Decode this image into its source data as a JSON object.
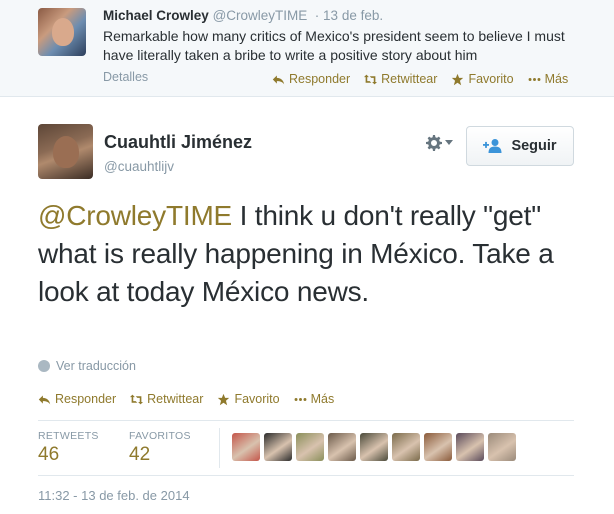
{
  "parent_tweet": {
    "author_name": "Michael Crowley",
    "author_handle": "@CrowleyTIME",
    "time": "13 de feb.",
    "text": "Remarkable how many critics of Mexico's president seem to believe I must have literally taken a bribe to write a positive story about him",
    "details_label": "Detalles",
    "actions": {
      "reply": "Responder",
      "retweet": "Retwittear",
      "favorite": "Favorito",
      "more": "Más"
    }
  },
  "tweet": {
    "author_name": "Cuauhtli Jiménez",
    "author_handle": "@cuauhtlijv",
    "follow_label": "Seguir",
    "mention": "@CrowleyTIME",
    "text": " I think u don't really \"get\" what is really happening in México. Take a look at today México news.",
    "translate_label": "Ver traducción",
    "actions": {
      "reply": "Responder",
      "retweet": "Retwittear",
      "favorite": "Favorito",
      "more": "Más"
    },
    "stats": {
      "retweets_label": "RETWEETS",
      "retweets_count": "46",
      "favorites_label": "FAVORITOS",
      "favorites_count": "42"
    },
    "favoriters_avatar_colors": [
      "#c4564a",
      "#2b2b2b",
      "#8a8f5a",
      "#6b5a4a",
      "#4a4a3a",
      "#7a6a4a",
      "#8a5a3a",
      "#5a4a5a",
      "#9a8a7a"
    ],
    "timestamp": "11:32 - 13 de feb. de 2014"
  },
  "colors": {
    "link": "#8f7a2d",
    "muted": "#8899a6",
    "text": "#292f33",
    "follow_icon": "#3b94d9"
  }
}
